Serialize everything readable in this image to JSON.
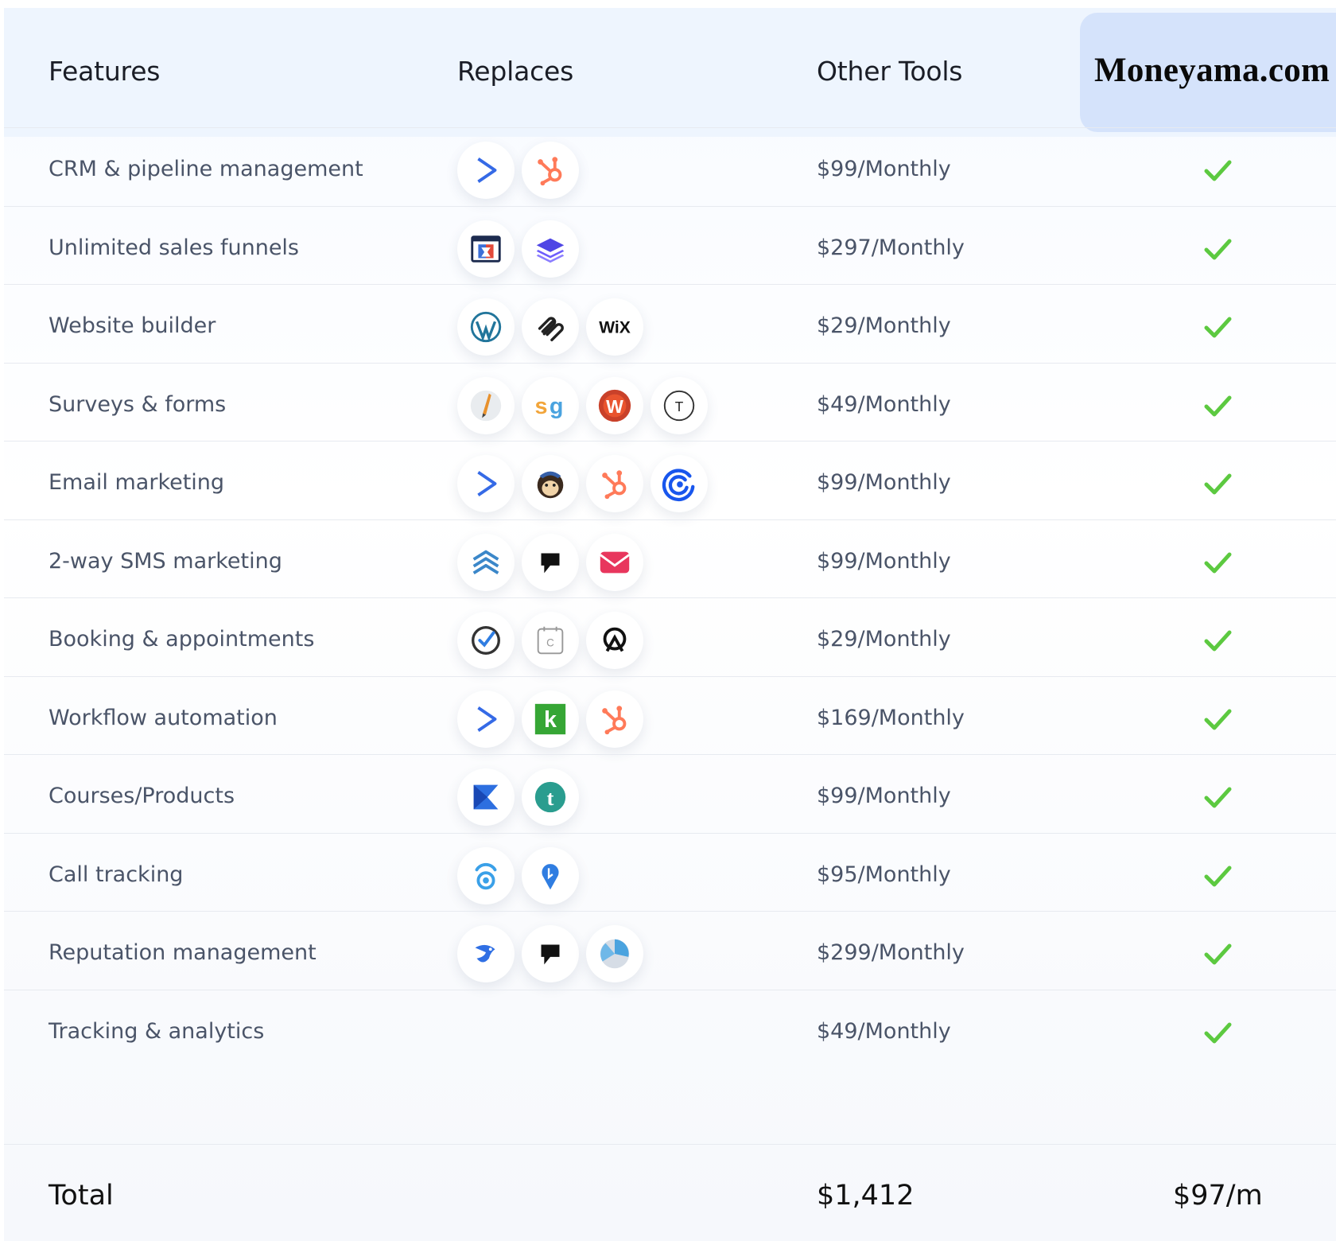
{
  "header": {
    "features": "Features",
    "replaces": "Replaces",
    "other_tools": "Other Tools",
    "brand": "Moneyama.com"
  },
  "rows": [
    {
      "feature": "CRM & pipeline management",
      "price": "$99/Monthly",
      "icons": [
        "activecampaign-icon",
        "hubspot-icon"
      ]
    },
    {
      "feature": "Unlimited sales funnels",
      "price": "$297/Monthly",
      "icons": [
        "clickfunnels-icon",
        "layers-stack-icon"
      ]
    },
    {
      "feature": "Website builder",
      "price": "$29/Monthly",
      "icons": [
        "wordpress-icon",
        "squarespace-icon",
        "wix-icon"
      ]
    },
    {
      "feature": "Surveys & forms",
      "price": "$49/Monthly",
      "icons": [
        "pencil-form-icon",
        "surveygizmo-icon",
        "wufoo-icon",
        "typeform-icon"
      ]
    },
    {
      "feature": "Email marketing",
      "price": "$99/Monthly",
      "icons": [
        "activecampaign-icon",
        "mailchimp-icon",
        "hubspot-icon",
        "constant-contact-icon"
      ]
    },
    {
      "feature": "2-way SMS marketing",
      "price": "$99/Monthly",
      "icons": [
        "stacked-chevrons-icon",
        "podium-flag-icon",
        "envelope-icon"
      ]
    },
    {
      "feature": "Booking & appointments",
      "price": "$29/Monthly",
      "icons": [
        "calendly-check-icon",
        "calendar-c-icon",
        "acuity-icon"
      ]
    },
    {
      "feature": "Workflow automation",
      "price": "$169/Monthly",
      "icons": [
        "activecampaign-icon",
        "keap-icon",
        "hubspot-icon"
      ]
    },
    {
      "feature": "Courses/Products",
      "price": "$99/Monthly",
      "icons": [
        "kajabi-icon",
        "teachable-icon"
      ]
    },
    {
      "feature": "Call tracking",
      "price": "$95/Monthly",
      "icons": [
        "callrail-icon",
        "location-pin-icon"
      ]
    },
    {
      "feature": "Reputation management",
      "price": "$299/Monthly",
      "icons": [
        "birdeye-icon",
        "podium-flag-icon",
        "reputation-pie-icon"
      ]
    },
    {
      "feature": "Tracking & analytics",
      "price": "$49/Monthly",
      "icons": []
    }
  ],
  "icon_glyphs": {
    "wix-icon": "WiX",
    "surveygizmo-icon": "sg",
    "wufoo-icon": "W",
    "typeform-icon": "T",
    "keap-icon": "k",
    "teachable-icon": "t",
    "calendar-c-icon": "C"
  },
  "total": {
    "label": "Total",
    "other": "$1,412",
    "brand": "$97/m"
  },
  "colors": {
    "header_bg": "#eef5fe",
    "brand_box": "#d5e3fb",
    "check": "#5cc940",
    "text_muted": "#4a5468"
  }
}
